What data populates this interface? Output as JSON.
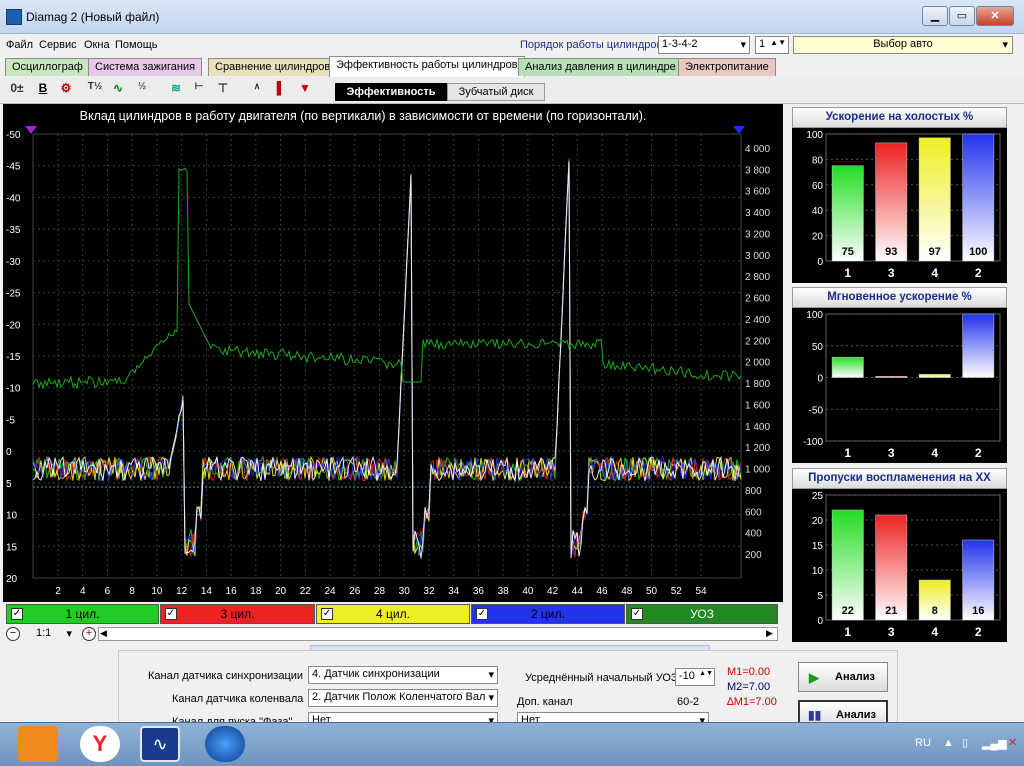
{
  "window": {
    "title": "Diamag 2 (Новый файл)"
  },
  "menu": [
    "Файл",
    "Сервис",
    "Окна",
    "Помощь"
  ],
  "firing_order": {
    "label": "Порядок работы цилиндров",
    "value": "1-3-4-2",
    "cyl": "1",
    "car_select": "Выбор авто"
  },
  "tabs": [
    {
      "label": "Осциллограф",
      "color": "#c8e6c0"
    },
    {
      "label": "Система зажигания",
      "color": "#e8c8e8"
    },
    {
      "label": "Сравнение цилиндров",
      "color": "#e8e0b8"
    },
    {
      "label": "Эффективность работы цилиндров",
      "color": "#ffffff",
      "active": true
    },
    {
      "label": "Анализ давления в цилиндре",
      "color": "#b8e0b8"
    },
    {
      "label": "Электропитание",
      "color": "#e8c8c0"
    }
  ],
  "subtabs": {
    "efficiency": "Эффективность",
    "gear": "Зубчатый диск"
  },
  "main_chart": {
    "title": "Вклад цилиндров в работу двигателя (по вертикали) в зависимости от времени (по горизонтали).",
    "left_ticks": [
      "-50",
      "-45",
      "-40",
      "-35",
      "-30",
      "-25",
      "-20",
      "-15",
      "-10",
      "-5",
      "0",
      "5",
      "10",
      "15",
      "20"
    ],
    "right_ticks": [
      "4 000",
      "3 800",
      "3 600",
      "3 400",
      "3 200",
      "3 000",
      "2 800",
      "2 600",
      "2 400",
      "2 200",
      "2 000",
      "1 800",
      "1 600",
      "1 400",
      "1 200",
      "1 000",
      "800",
      "600",
      "400",
      "200"
    ],
    "x_ticks": [
      "2",
      "4",
      "6",
      "8",
      "10",
      "12",
      "14",
      "16",
      "18",
      "20",
      "22",
      "24",
      "26",
      "28",
      "30",
      "32",
      "34",
      "36",
      "38",
      "40",
      "42",
      "44",
      "46",
      "48",
      "50",
      "52",
      "54"
    ]
  },
  "channels": [
    {
      "label": "1 цил.",
      "color": "#22cc22"
    },
    {
      "label": "3 цил.",
      "color": "#ee2222"
    },
    {
      "label": "4 цил.",
      "color": "#eeee22"
    },
    {
      "label": "2 цил.",
      "color": "#2233ee"
    },
    {
      "label": "УОЗ",
      "color": "#228822"
    }
  ],
  "zoom": {
    "value": "1:1"
  },
  "chart_data": [
    {
      "type": "bar",
      "title": "Ускорение на холостых %",
      "categories": [
        "1",
        "3",
        "4",
        "2"
      ],
      "values": [
        75,
        93,
        97,
        100
      ],
      "ylim": [
        0,
        100
      ],
      "yticks": [
        "100",
        "80",
        "60",
        "40",
        "20",
        "0"
      ],
      "colors": [
        "#22dd22",
        "#ee2222",
        "#eeee22",
        "#2233ee"
      ],
      "labels": [
        "75",
        "93",
        "97",
        "100"
      ]
    },
    {
      "type": "bar",
      "title": "Мгновенное ускорение %",
      "categories": [
        "1",
        "3",
        "4",
        "2"
      ],
      "values": [
        32,
        2,
        5,
        100
      ],
      "ylim": [
        -100,
        100
      ],
      "yticks": [
        "100",
        "50",
        "0",
        "-50",
        "-100"
      ],
      "colors": [
        "#22dd22",
        "#ee2222",
        "#eeee22",
        "#2233ee"
      ]
    },
    {
      "type": "bar",
      "title": "Пропуски воспламенения на ХХ",
      "categories": [
        "1",
        "3",
        "4",
        "2"
      ],
      "values": [
        22,
        21,
        8,
        16
      ],
      "ylim": [
        0,
        25
      ],
      "yticks": [
        "25",
        "20",
        "15",
        "10",
        "5",
        "0"
      ],
      "colors": [
        "#22dd22",
        "#ee2222",
        "#eeee22",
        "#2233ee"
      ],
      "labels": [
        "22",
        "21",
        "8",
        "16"
      ]
    }
  ],
  "bottom": {
    "sync_label": "Канал датчика синхронизации",
    "sync_value": "4. Датчик синхронизации",
    "crank_label": "Канал датчика коленвала",
    "crank_value": "2. Датчик Полож Коленчатого Вал",
    "phase_label": "Канал для пуска \"Фаза\"",
    "phase_value": "Нет",
    "avg_label": "Усреднённый начальный УОЗ",
    "avg_value": "-10",
    "extra_label": "Доп. канал",
    "extra_value": "Нет",
    "teeth": "60-2",
    "m1": "M1=0.00",
    "m2": "M2=7.00",
    "dm": "∆M1=7.00",
    "analyze1": "Анализ",
    "analyze2": "Анализ"
  },
  "tray": {
    "lang": "RU"
  }
}
